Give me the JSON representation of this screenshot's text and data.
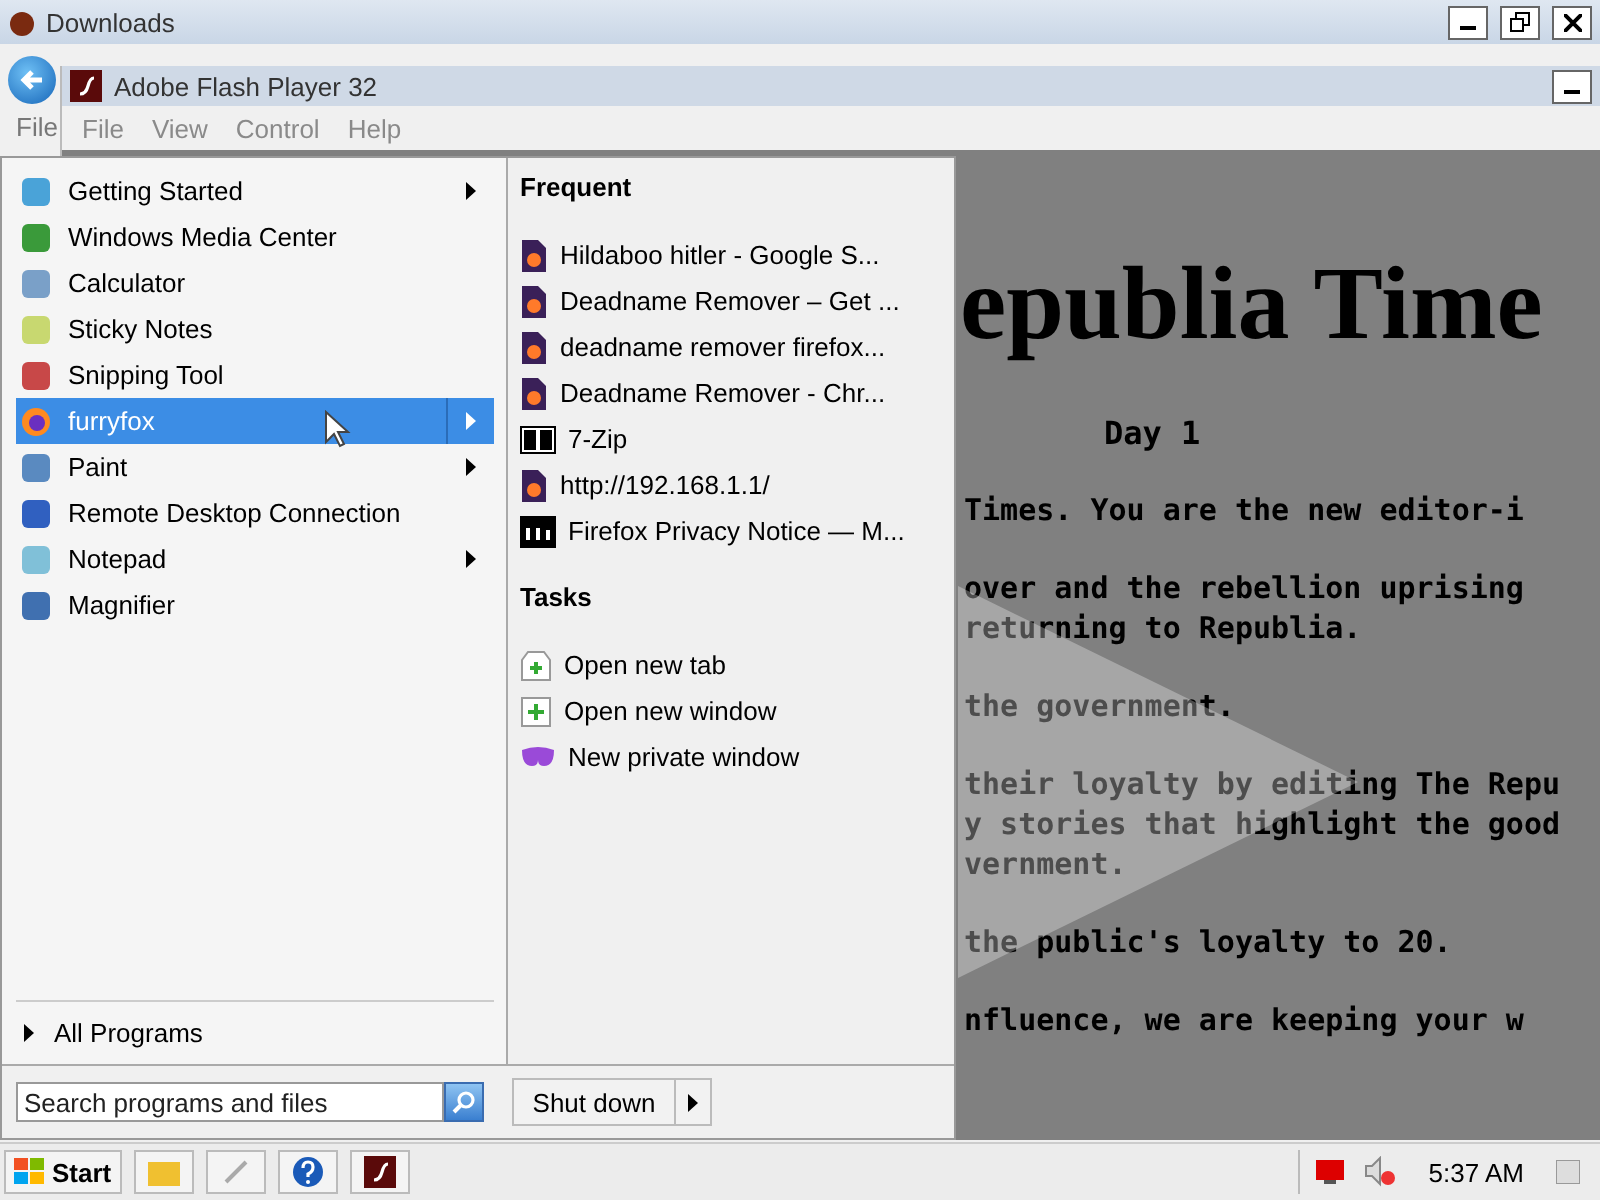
{
  "window": {
    "title": "Downloads",
    "menu": [
      "File"
    ]
  },
  "player": {
    "title": "Adobe Flash Player 32",
    "menu": [
      "File",
      "View",
      "Control",
      "Help"
    ]
  },
  "game": {
    "title": "epublia Time",
    "day": "Day 1",
    "lines": [
      "Times. You are the new editor-i",
      "over and the rebellion uprising",
      "returning to Republia.",
      "the government.",
      "their loyalty by editing The Repu",
      "y stories that highlight the good",
      "vernment.",
      "the public's loyalty to 20.",
      "nfluence, we are keeping your w"
    ]
  },
  "start_menu": {
    "programs": [
      {
        "label": "Getting Started",
        "submenu": true,
        "selected": false
      },
      {
        "label": "Windows Media Center",
        "submenu": false,
        "selected": false
      },
      {
        "label": "Calculator",
        "submenu": false,
        "selected": false
      },
      {
        "label": "Sticky Notes",
        "submenu": false,
        "selected": false
      },
      {
        "label": "Snipping Tool",
        "submenu": false,
        "selected": false
      },
      {
        "label": "furryfox",
        "submenu": true,
        "selected": true
      },
      {
        "label": "Paint",
        "submenu": true,
        "selected": false
      },
      {
        "label": "Remote Desktop Connection",
        "submenu": false,
        "selected": false
      },
      {
        "label": "Notepad",
        "submenu": true,
        "selected": false
      },
      {
        "label": "Magnifier",
        "submenu": false,
        "selected": false
      }
    ],
    "all_programs": "All Programs",
    "search": {
      "placeholder": "Search programs and files"
    },
    "shutdown": "Shut down",
    "jump_list": [
      {
        "title": "Frequent",
        "items": [
          {
            "label": "Hildaboo hitler - Google S...",
            "kind": "page"
          },
          {
            "label": "Deadname Remover – Get ...",
            "kind": "page"
          },
          {
            "label": "deadname remover firefox...",
            "kind": "page"
          },
          {
            "label": "Deadname Remover - Chr...",
            "kind": "page"
          },
          {
            "label": "7-Zip",
            "kind": "archive"
          },
          {
            "label": "http://192.168.1.1/",
            "kind": "page"
          },
          {
            "label": "Firefox Privacy Notice — M...",
            "kind": "site"
          }
        ]
      },
      {
        "title": "Tasks",
        "items": [
          {
            "label": "Open new tab",
            "kind": "tab"
          },
          {
            "label": "Open new window",
            "kind": "window"
          },
          {
            "label": "New private window",
            "kind": "private"
          }
        ]
      }
    ]
  },
  "taskbar": {
    "start": "Start",
    "clock": "5:37 AM"
  }
}
